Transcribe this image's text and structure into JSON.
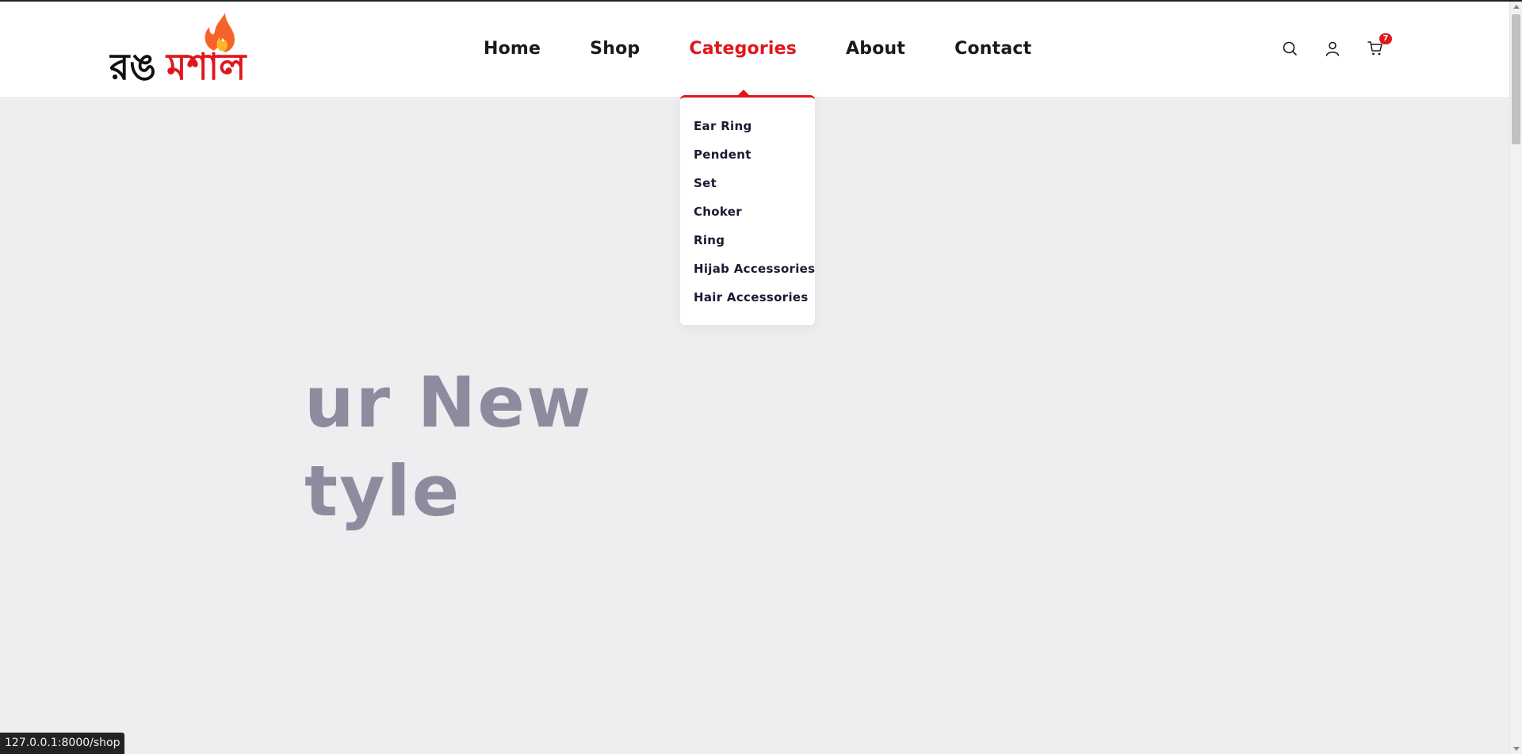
{
  "header": {
    "logo": {
      "text_black": "রঙ",
      "text_red": "মশাল",
      "icon": "flame-icon",
      "colors": {
        "black": "#111111",
        "red": "#e0161c",
        "flame_outer": "#f5632a",
        "flame_inner": "#ffb627"
      }
    },
    "nav": [
      {
        "label": "Home",
        "active": false
      },
      {
        "label": "Shop",
        "active": false
      },
      {
        "label": "Categories",
        "active": true
      },
      {
        "label": "About",
        "active": false
      },
      {
        "label": "Contact",
        "active": false
      }
    ],
    "icons": {
      "search": "search-icon",
      "account": "user-icon",
      "cart": "cart-icon",
      "cart_count": "7"
    }
  },
  "categories_dropdown": {
    "items": [
      "Ear Ring",
      "Pendent",
      "Set",
      "Choker",
      "Ring",
      "Hijab Accessories",
      "Hair Accessories"
    ]
  },
  "hero": {
    "line1": "ur New",
    "line2": "tyle"
  },
  "status_bar": {
    "url": "127.0.0.1:8000/shop"
  },
  "colors": {
    "accent": "#e0161c",
    "background": "#eeeef0",
    "hero_text": "#8e8b9f",
    "nav_text": "#1a1a1a"
  }
}
